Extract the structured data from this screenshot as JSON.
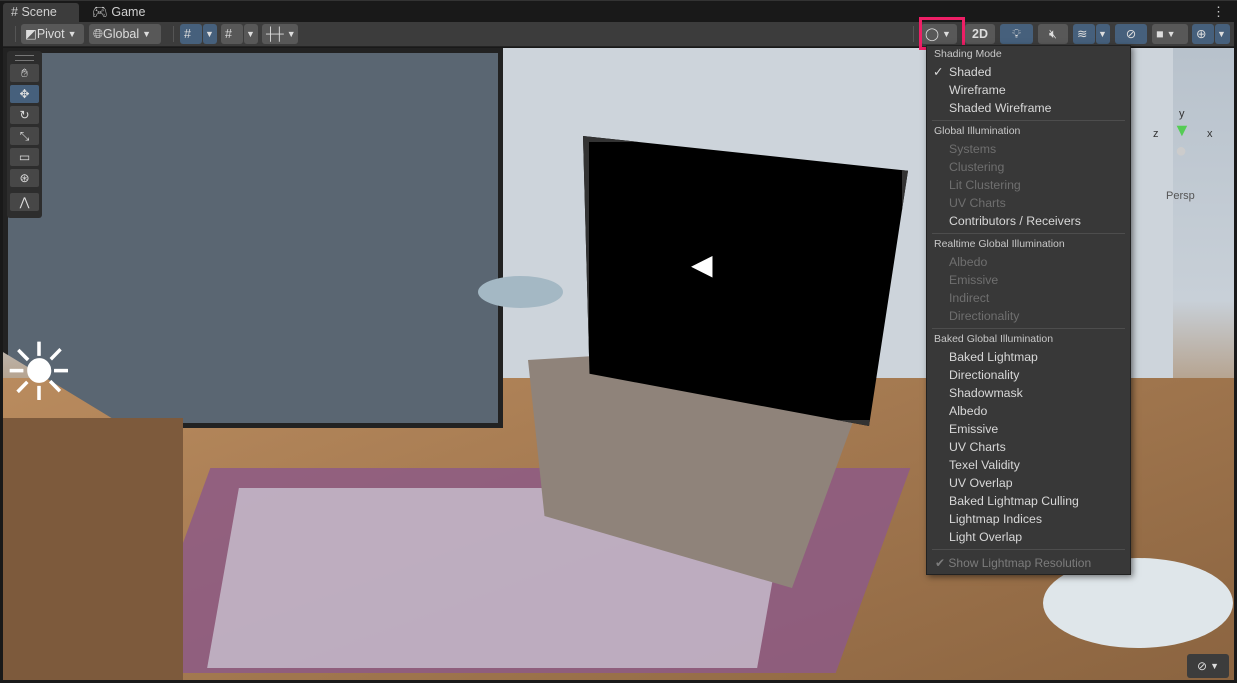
{
  "tabs": [
    {
      "label": "Scene",
      "icon": "grid-icon"
    },
    {
      "label": "Game",
      "icon": "gamepad-icon"
    }
  ],
  "toolbar": {
    "pivot": "Pivot",
    "global": "Global",
    "mode_2d": "2D"
  },
  "tools": [
    "hand",
    "move",
    "rotate",
    "scale",
    "rect",
    "transform",
    "custom"
  ],
  "gizmo": {
    "y": "y",
    "x": "x",
    "z": "z",
    "persp": "Persp"
  },
  "menu": {
    "sections": [
      {
        "header": "Shading Mode",
        "items": [
          {
            "label": "Shaded",
            "checked": true,
            "enabled": true
          },
          {
            "label": "Wireframe",
            "enabled": true
          },
          {
            "label": "Shaded Wireframe",
            "enabled": true
          }
        ]
      },
      {
        "header": "Global Illumination",
        "items": [
          {
            "label": "Systems",
            "enabled": false
          },
          {
            "label": "Clustering",
            "enabled": false
          },
          {
            "label": "Lit Clustering",
            "enabled": false
          },
          {
            "label": "UV Charts",
            "enabled": false
          },
          {
            "label": "Contributors / Receivers",
            "enabled": true
          }
        ]
      },
      {
        "header": "Realtime Global Illumination",
        "items": [
          {
            "label": "Albedo",
            "enabled": false
          },
          {
            "label": "Emissive",
            "enabled": false
          },
          {
            "label": "Indirect",
            "enabled": false
          },
          {
            "label": "Directionality",
            "enabled": false
          }
        ]
      },
      {
        "header": "Baked Global Illumination",
        "items": [
          {
            "label": "Baked Lightmap",
            "enabled": true
          },
          {
            "label": "Directionality",
            "enabled": true
          },
          {
            "label": "Shadowmask",
            "enabled": true
          },
          {
            "label": "Albedo",
            "enabled": true
          },
          {
            "label": "Emissive",
            "enabled": true
          },
          {
            "label": "UV Charts",
            "enabled": true
          },
          {
            "label": "Texel Validity",
            "enabled": true
          },
          {
            "label": "UV Overlap",
            "enabled": true
          },
          {
            "label": "Baked Lightmap Culling",
            "enabled": true
          },
          {
            "label": "Lightmap Indices",
            "enabled": true
          },
          {
            "label": "Light Overlap",
            "enabled": true
          }
        ]
      }
    ],
    "footer": "Show Lightmap Resolution",
    "checkmark": "✓",
    "footer_check": "✔"
  },
  "colors": {
    "highlight": "#ee1f66",
    "active": "#46607c"
  }
}
